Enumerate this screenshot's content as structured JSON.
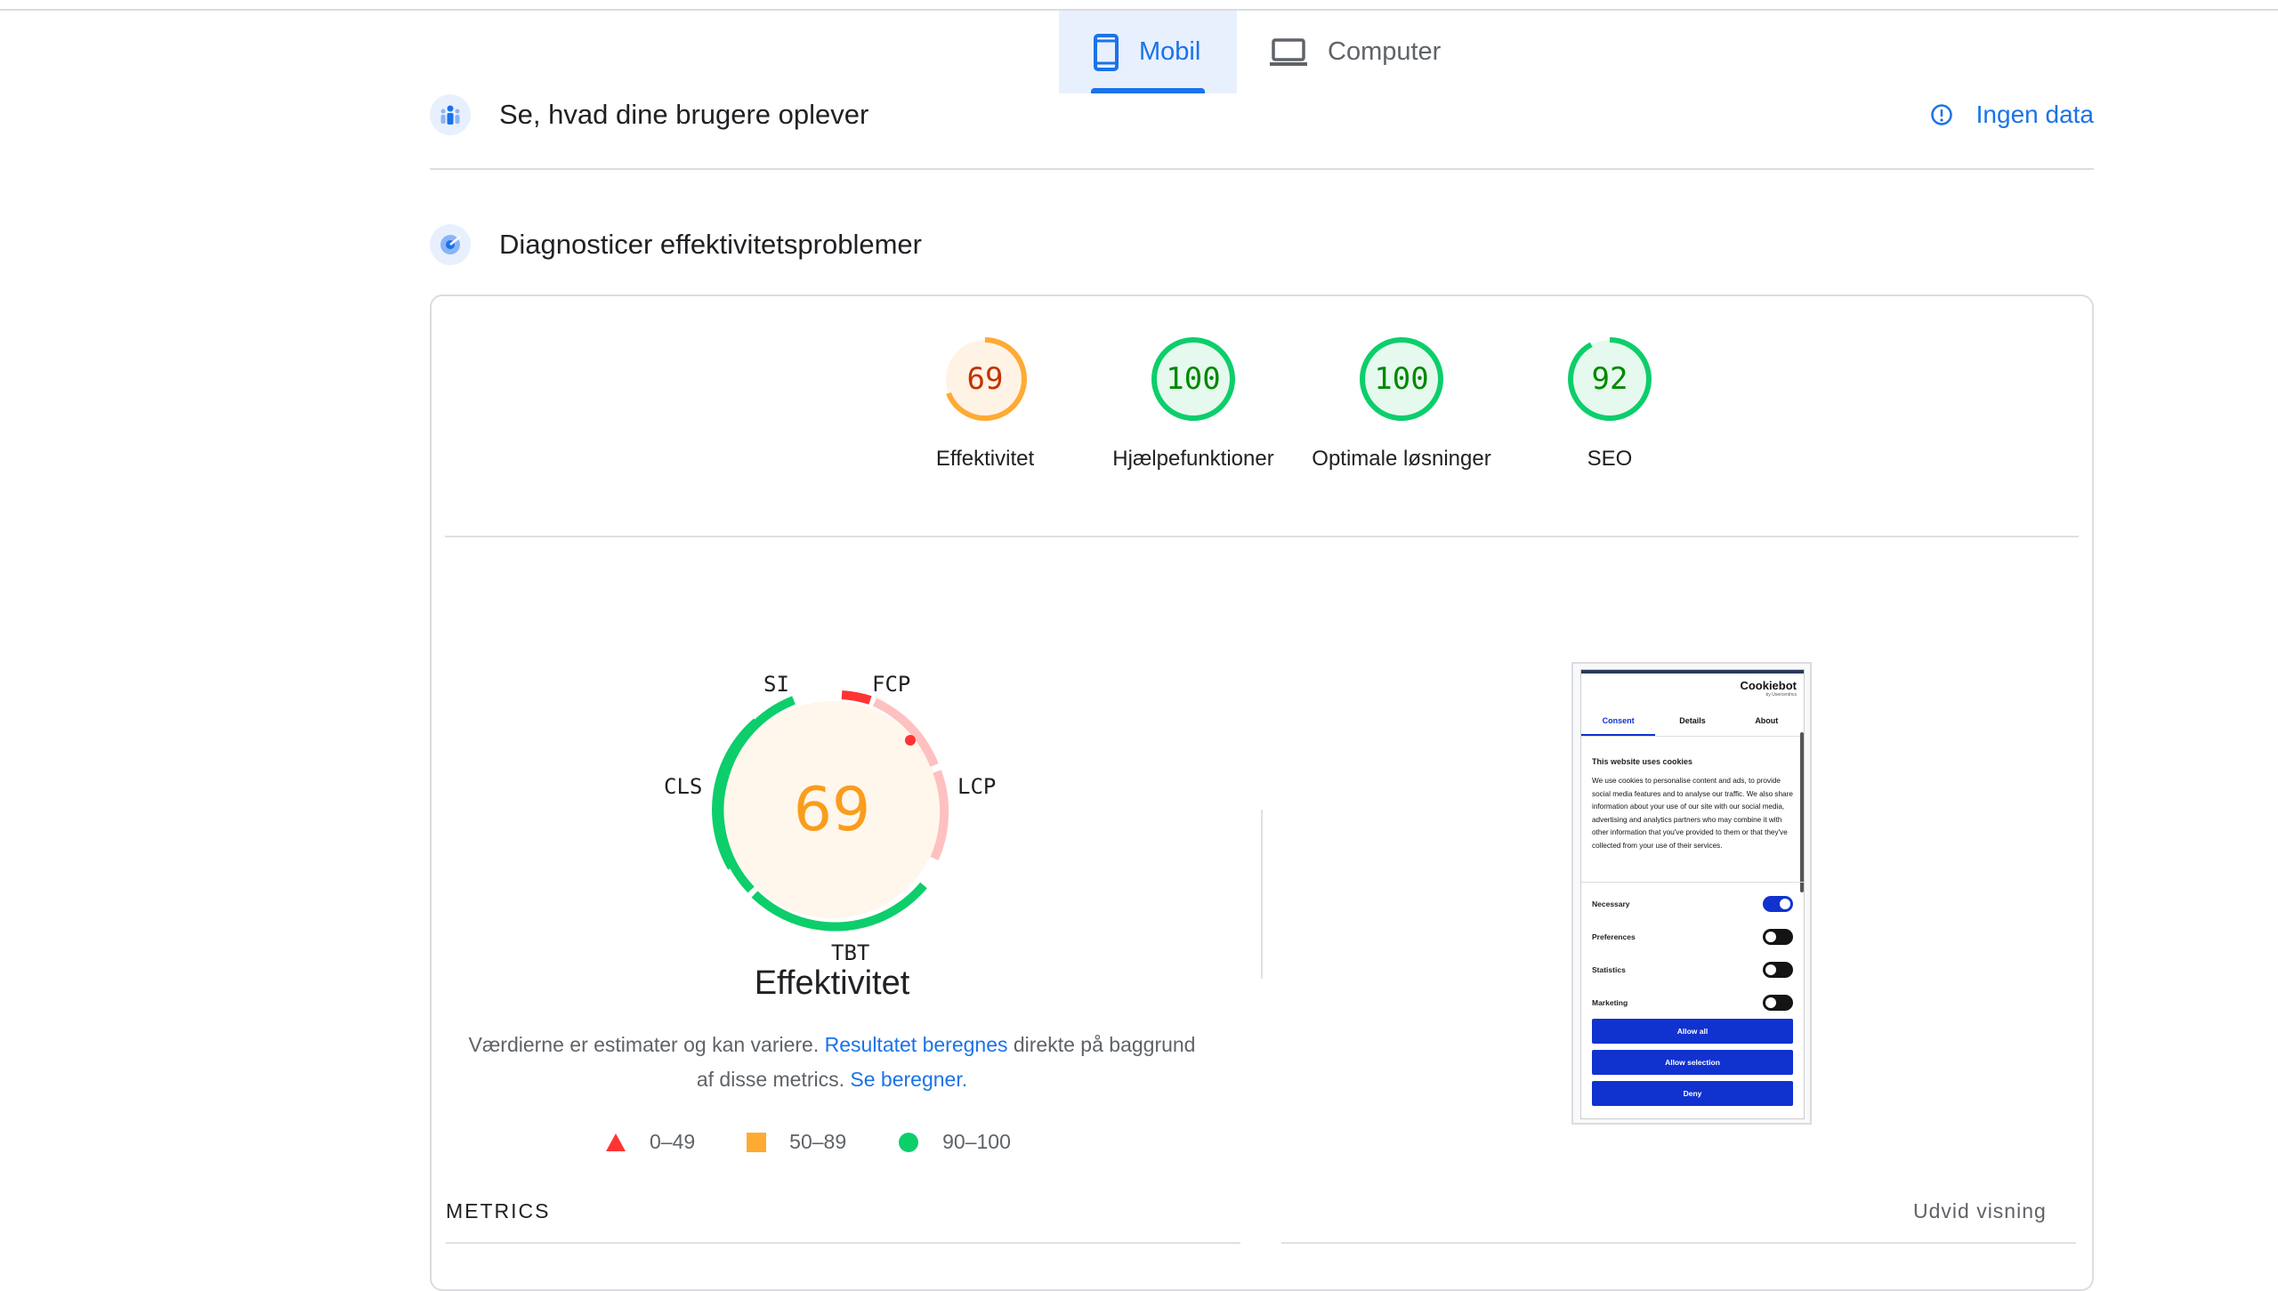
{
  "tabs": [
    {
      "label": "Mobil",
      "icon": "smartphone-icon",
      "active": true
    },
    {
      "label": "Computer",
      "icon": "laptop-icon",
      "active": false
    }
  ],
  "field_section": {
    "title": "Se, hvad dine brugere oplever",
    "status": "Ingen data"
  },
  "lab_section": {
    "title": "Diagnosticer effektivitetsproblemer"
  },
  "categories": [
    {
      "label": "Effektivitet",
      "score": "69",
      "status": "average"
    },
    {
      "label": "Hjælpefunktioner",
      "score": "100",
      "status": "pass"
    },
    {
      "label": "Optimale løsninger",
      "score": "100",
      "status": "pass"
    },
    {
      "label": "SEO",
      "score": "92",
      "status": "pass"
    }
  ],
  "performance": {
    "score": "69",
    "title": "Effektivitet",
    "metric_labels": {
      "si": "SI",
      "fcp": "FCP",
      "lcp": "LCP",
      "tbt": "TBT",
      "cls": "CLS"
    },
    "desc": {
      "part1": "Værdierne er estimater og kan variere. ",
      "link1": "Resultatet beregnes",
      "part2": " direkte på baggrund af disse metrics. ",
      "link2": "Se beregner."
    }
  },
  "legend": [
    {
      "range": "0–49",
      "color": "#ff3333",
      "shape": "triangle"
    },
    {
      "range": "50–89",
      "color": "#ffaa33",
      "shape": "square"
    },
    {
      "range": "90–100",
      "color": "#0cce6b",
      "shape": "circle"
    }
  ],
  "screenshot": {
    "brand": "Cookiebot",
    "brand_sub": "by Usercentrics",
    "tabs": [
      "Consent",
      "Details",
      "About"
    ],
    "heading": "This website uses cookies",
    "text": "We use cookies to personalise content and ads, to provide social media features and to analyse our traffic. We also share information about your use of our site with our social media, advertising and analytics partners who may combine it with other information that you've provided to them or that they've collected from your use of their services.",
    "toggles": [
      {
        "label": "Necessary",
        "on": true
      },
      {
        "label": "Preferences",
        "on": false
      },
      {
        "label": "Statistics",
        "on": false
      },
      {
        "label": "Marketing",
        "on": false
      }
    ],
    "buttons": [
      "Allow all",
      "Allow selection",
      "Deny"
    ]
  },
  "bottom": {
    "metrics_label": "METRICS",
    "expand_label": "Udvid visning"
  },
  "colors": {
    "accent": "#1a73e8",
    "pass": "#0cce6b",
    "average": "#ffaa33",
    "fail": "#ff3333"
  }
}
